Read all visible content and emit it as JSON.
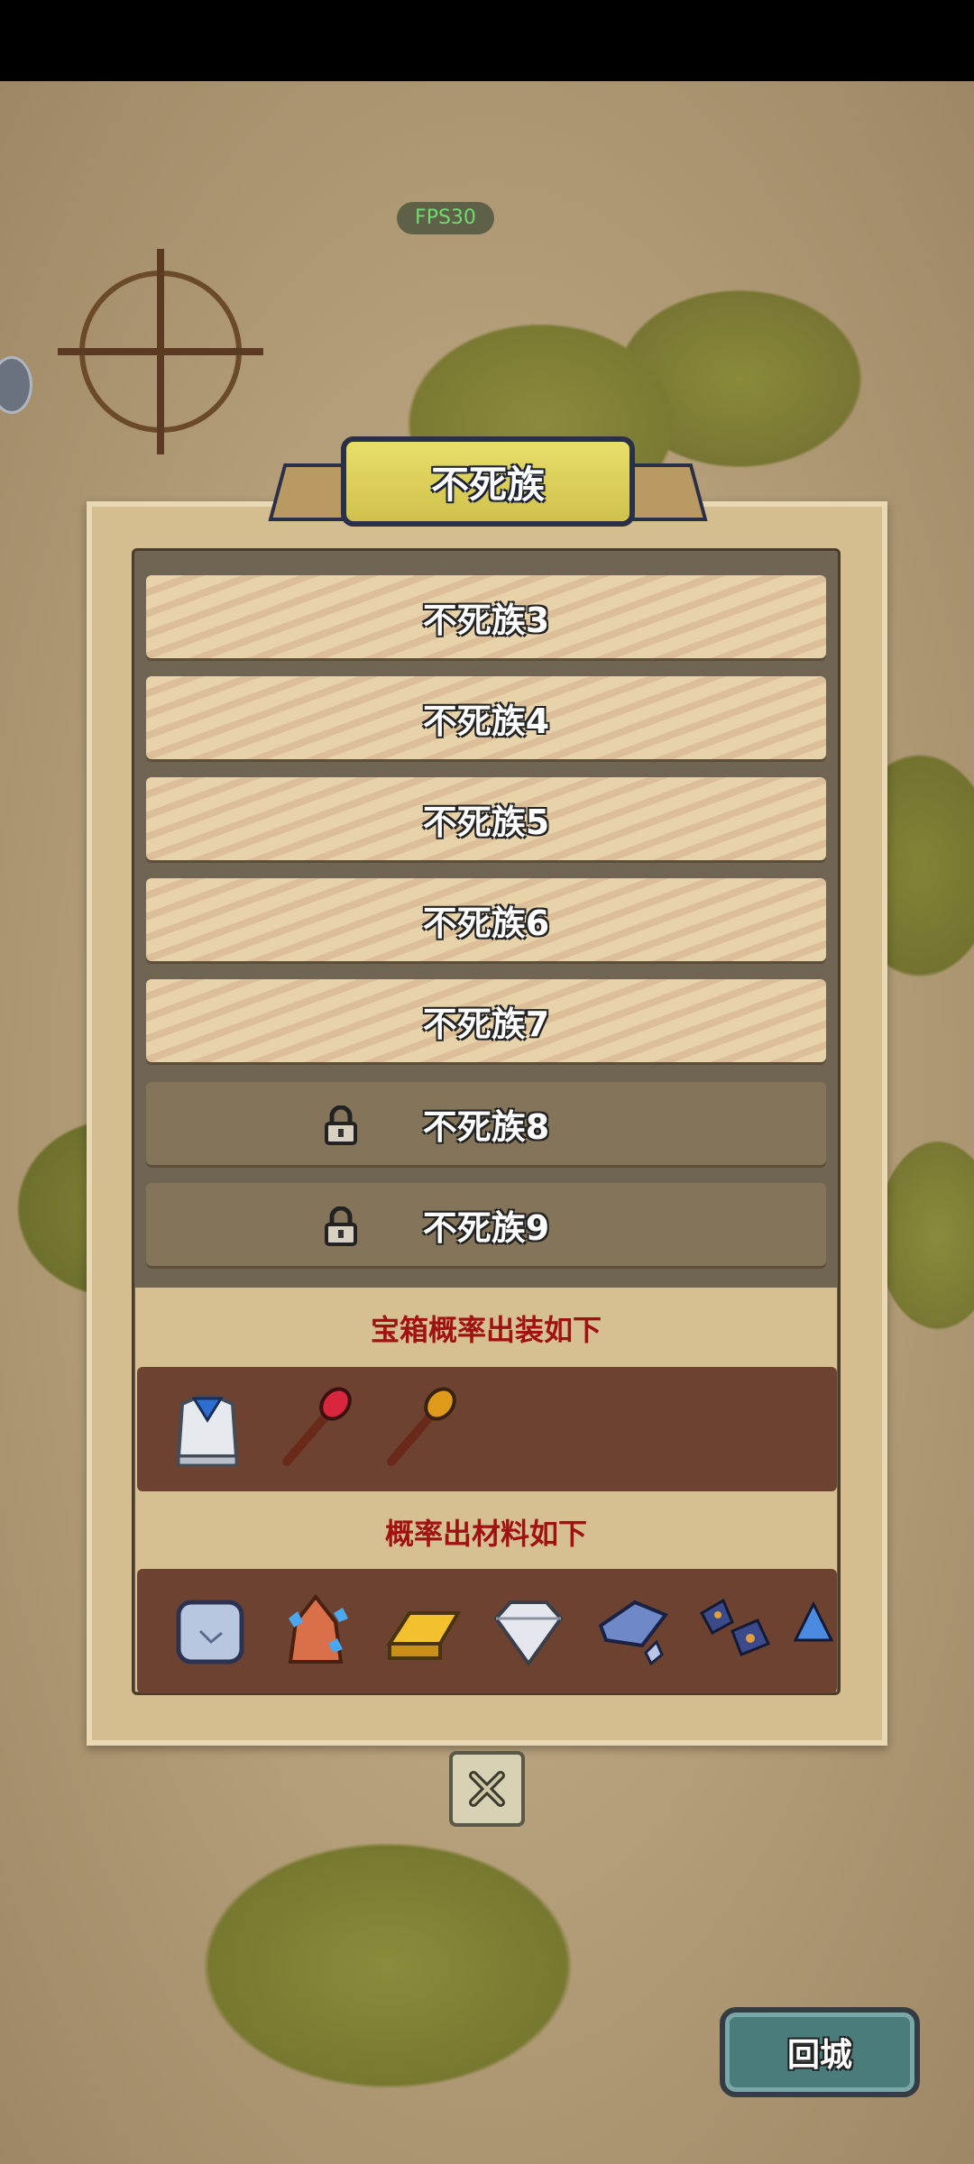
{
  "hud": {
    "fps": "FPS30"
  },
  "dialog": {
    "title": "不死族",
    "levels": [
      {
        "label": "不死族3",
        "locked": false
      },
      {
        "label": "不死族4",
        "locked": false
      },
      {
        "label": "不死族5",
        "locked": false
      },
      {
        "label": "不死族6",
        "locked": false
      },
      {
        "label": "不死族7",
        "locked": false
      },
      {
        "label": "不死族8",
        "locked": true
      },
      {
        "label": "不死族9",
        "locked": true
      }
    ],
    "equipment_heading": "宝箱概率出装如下",
    "equipment_items": [
      "armor-icon",
      "red-staff-icon",
      "orange-staff-icon"
    ],
    "materials_heading": "概率出材料如下",
    "material_items": [
      "stone-block-icon",
      "crystal-ore-icon",
      "gold-bar-icon",
      "diamond-icon",
      "iron-ore-icon",
      "blue-ore-icon",
      "partial-ore-icon"
    ]
  },
  "buttons": {
    "close": "close-icon",
    "return_label": "回城"
  },
  "colors": {
    "heading_red": "#a01212",
    "strip_brown": "#6e4230",
    "banner_yellow": "#e3d764"
  }
}
